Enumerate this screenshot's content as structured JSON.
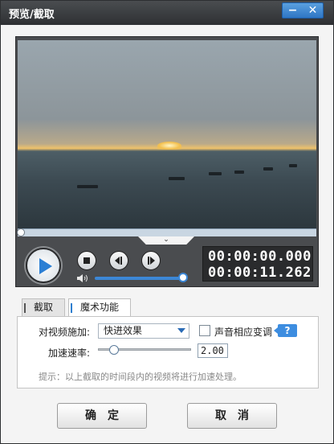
{
  "window": {
    "title": "预览/截取",
    "minimize_glyph": "−",
    "close_glyph": "✕"
  },
  "player": {
    "progress": 0,
    "volume": 1,
    "time_current": "00:00:00.000",
    "time_total": "00:00:11.262",
    "collapse_glyph": "⌄"
  },
  "tabs": [
    {
      "label": "截取"
    },
    {
      "label": "魔术功能"
    }
  ],
  "magic": {
    "apply_label": "对视频施加:",
    "effect_value": "快进效果",
    "pitch_label": "声音相应变调",
    "pitch_checked": false,
    "help_label": "?",
    "rate_label": "加速速率:",
    "rate_value": "2.00",
    "hint": "提示：以上截取的时间段内的视频将进行加速处理。"
  },
  "buttons": {
    "ok": "确定",
    "cancel": "取消"
  },
  "colors": {
    "accent": "#3c87d6",
    "titlebar": "#3b3e41"
  },
  "icons": [
    "play-icon",
    "stop-icon",
    "prev-frame-icon",
    "next-frame-icon",
    "speaker-icon",
    "help-icon"
  ]
}
